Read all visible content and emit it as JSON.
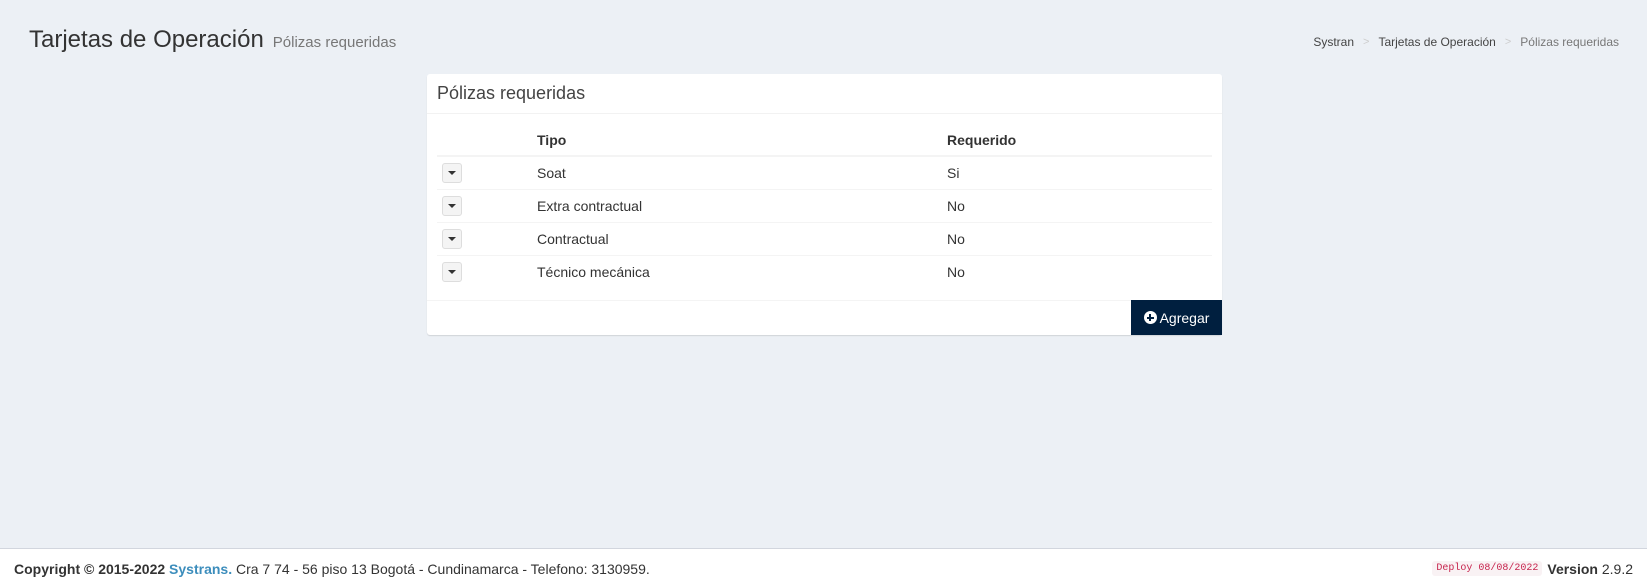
{
  "header": {
    "title": "Tarjetas de Operación",
    "subtitle": "Pólizas requeridas"
  },
  "breadcrumb": {
    "items": [
      "Systran",
      "Tarjetas de Operación",
      "Pólizas requeridas"
    ],
    "separator": ">"
  },
  "box": {
    "title": "Pólizas requeridas",
    "columns": [
      "",
      "Tipo",
      "Requerido"
    ],
    "rows": [
      {
        "tipo": "Soat",
        "requerido": "Si"
      },
      {
        "tipo": "Extra contractual",
        "requerido": "No"
      },
      {
        "tipo": "Contractual",
        "requerido": "No"
      },
      {
        "tipo": "Técnico mecánica",
        "requerido": "No"
      }
    ],
    "add_button_label": "Agregar",
    "add_button_icon": "plus-circle-icon",
    "row_action_icon": "caret-down-icon"
  },
  "footer": {
    "copyright": "Copyright © 2015-2022",
    "brand": "Systrans.",
    "address": "Cra 7 74 - 56 piso 13 Bogotá - Cundinamarca - Telefono: 3130959.",
    "deploy": "Deploy 08/08/2022",
    "version_label": "Version",
    "version_number": "2.9.2"
  },
  "colors": {
    "background": "#ecf0f5",
    "primary_button": "#001f3f",
    "link": "#3c8dbc"
  }
}
